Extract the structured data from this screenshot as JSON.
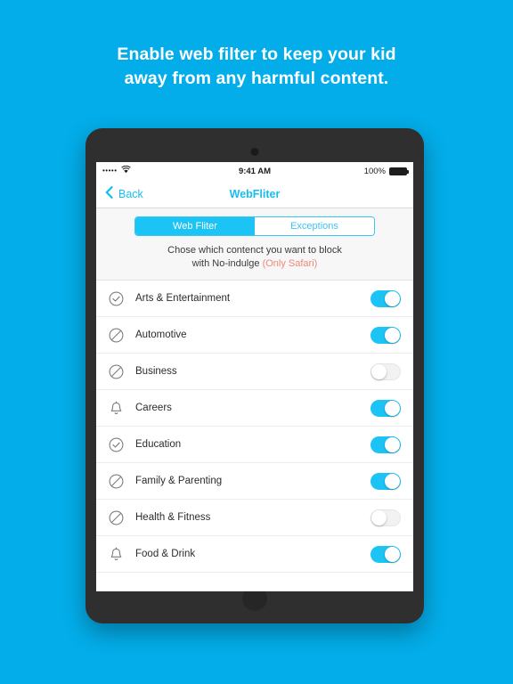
{
  "headline": {
    "line1": "Enable web filter to keep your kid",
    "line2": "away from any harmful content."
  },
  "colors": {
    "background": "#03ade9",
    "accent": "#1bc4f5",
    "link": "#16bef0",
    "warning": "#f08878",
    "device_bezel": "#2f2f2f"
  },
  "status_bar": {
    "signal_dots": "•••••",
    "wifi_icon": "wifi-icon",
    "time": "9:41 AM",
    "battery_percent": "100%",
    "battery_icon": "battery-full-icon"
  },
  "nav_bar": {
    "back_label": "Back",
    "back_icon": "chevron-left-icon",
    "title": "WebFliter"
  },
  "segmented_control": {
    "options": [
      {
        "label": "Web Fliter",
        "selected": true
      },
      {
        "label": "Exceptions",
        "selected": false
      }
    ]
  },
  "description": {
    "line1": "Chose which contenct you want to block",
    "line2_prefix": "with No-indulge",
    "line2_note": "(Only Safari)"
  },
  "list": {
    "rows": [
      {
        "label": "Arts & Entertainment",
        "icon": "check-circle-icon",
        "toggle": "on"
      },
      {
        "label": "Automotive",
        "icon": "slash-circle-icon",
        "toggle": "on"
      },
      {
        "label": "Business",
        "icon": "slash-circle-icon",
        "toggle": "off"
      },
      {
        "label": "Careers",
        "icon": "bell-icon",
        "toggle": "on"
      },
      {
        "label": "Education",
        "icon": "check-circle-icon",
        "toggle": "on"
      },
      {
        "label": "Family & Parenting",
        "icon": "slash-circle-icon",
        "toggle": "on"
      },
      {
        "label": "Health & Fitness",
        "icon": "slash-circle-icon",
        "toggle": "off"
      },
      {
        "label": "Food & Drink",
        "icon": "bell-icon",
        "toggle": "on"
      }
    ]
  }
}
